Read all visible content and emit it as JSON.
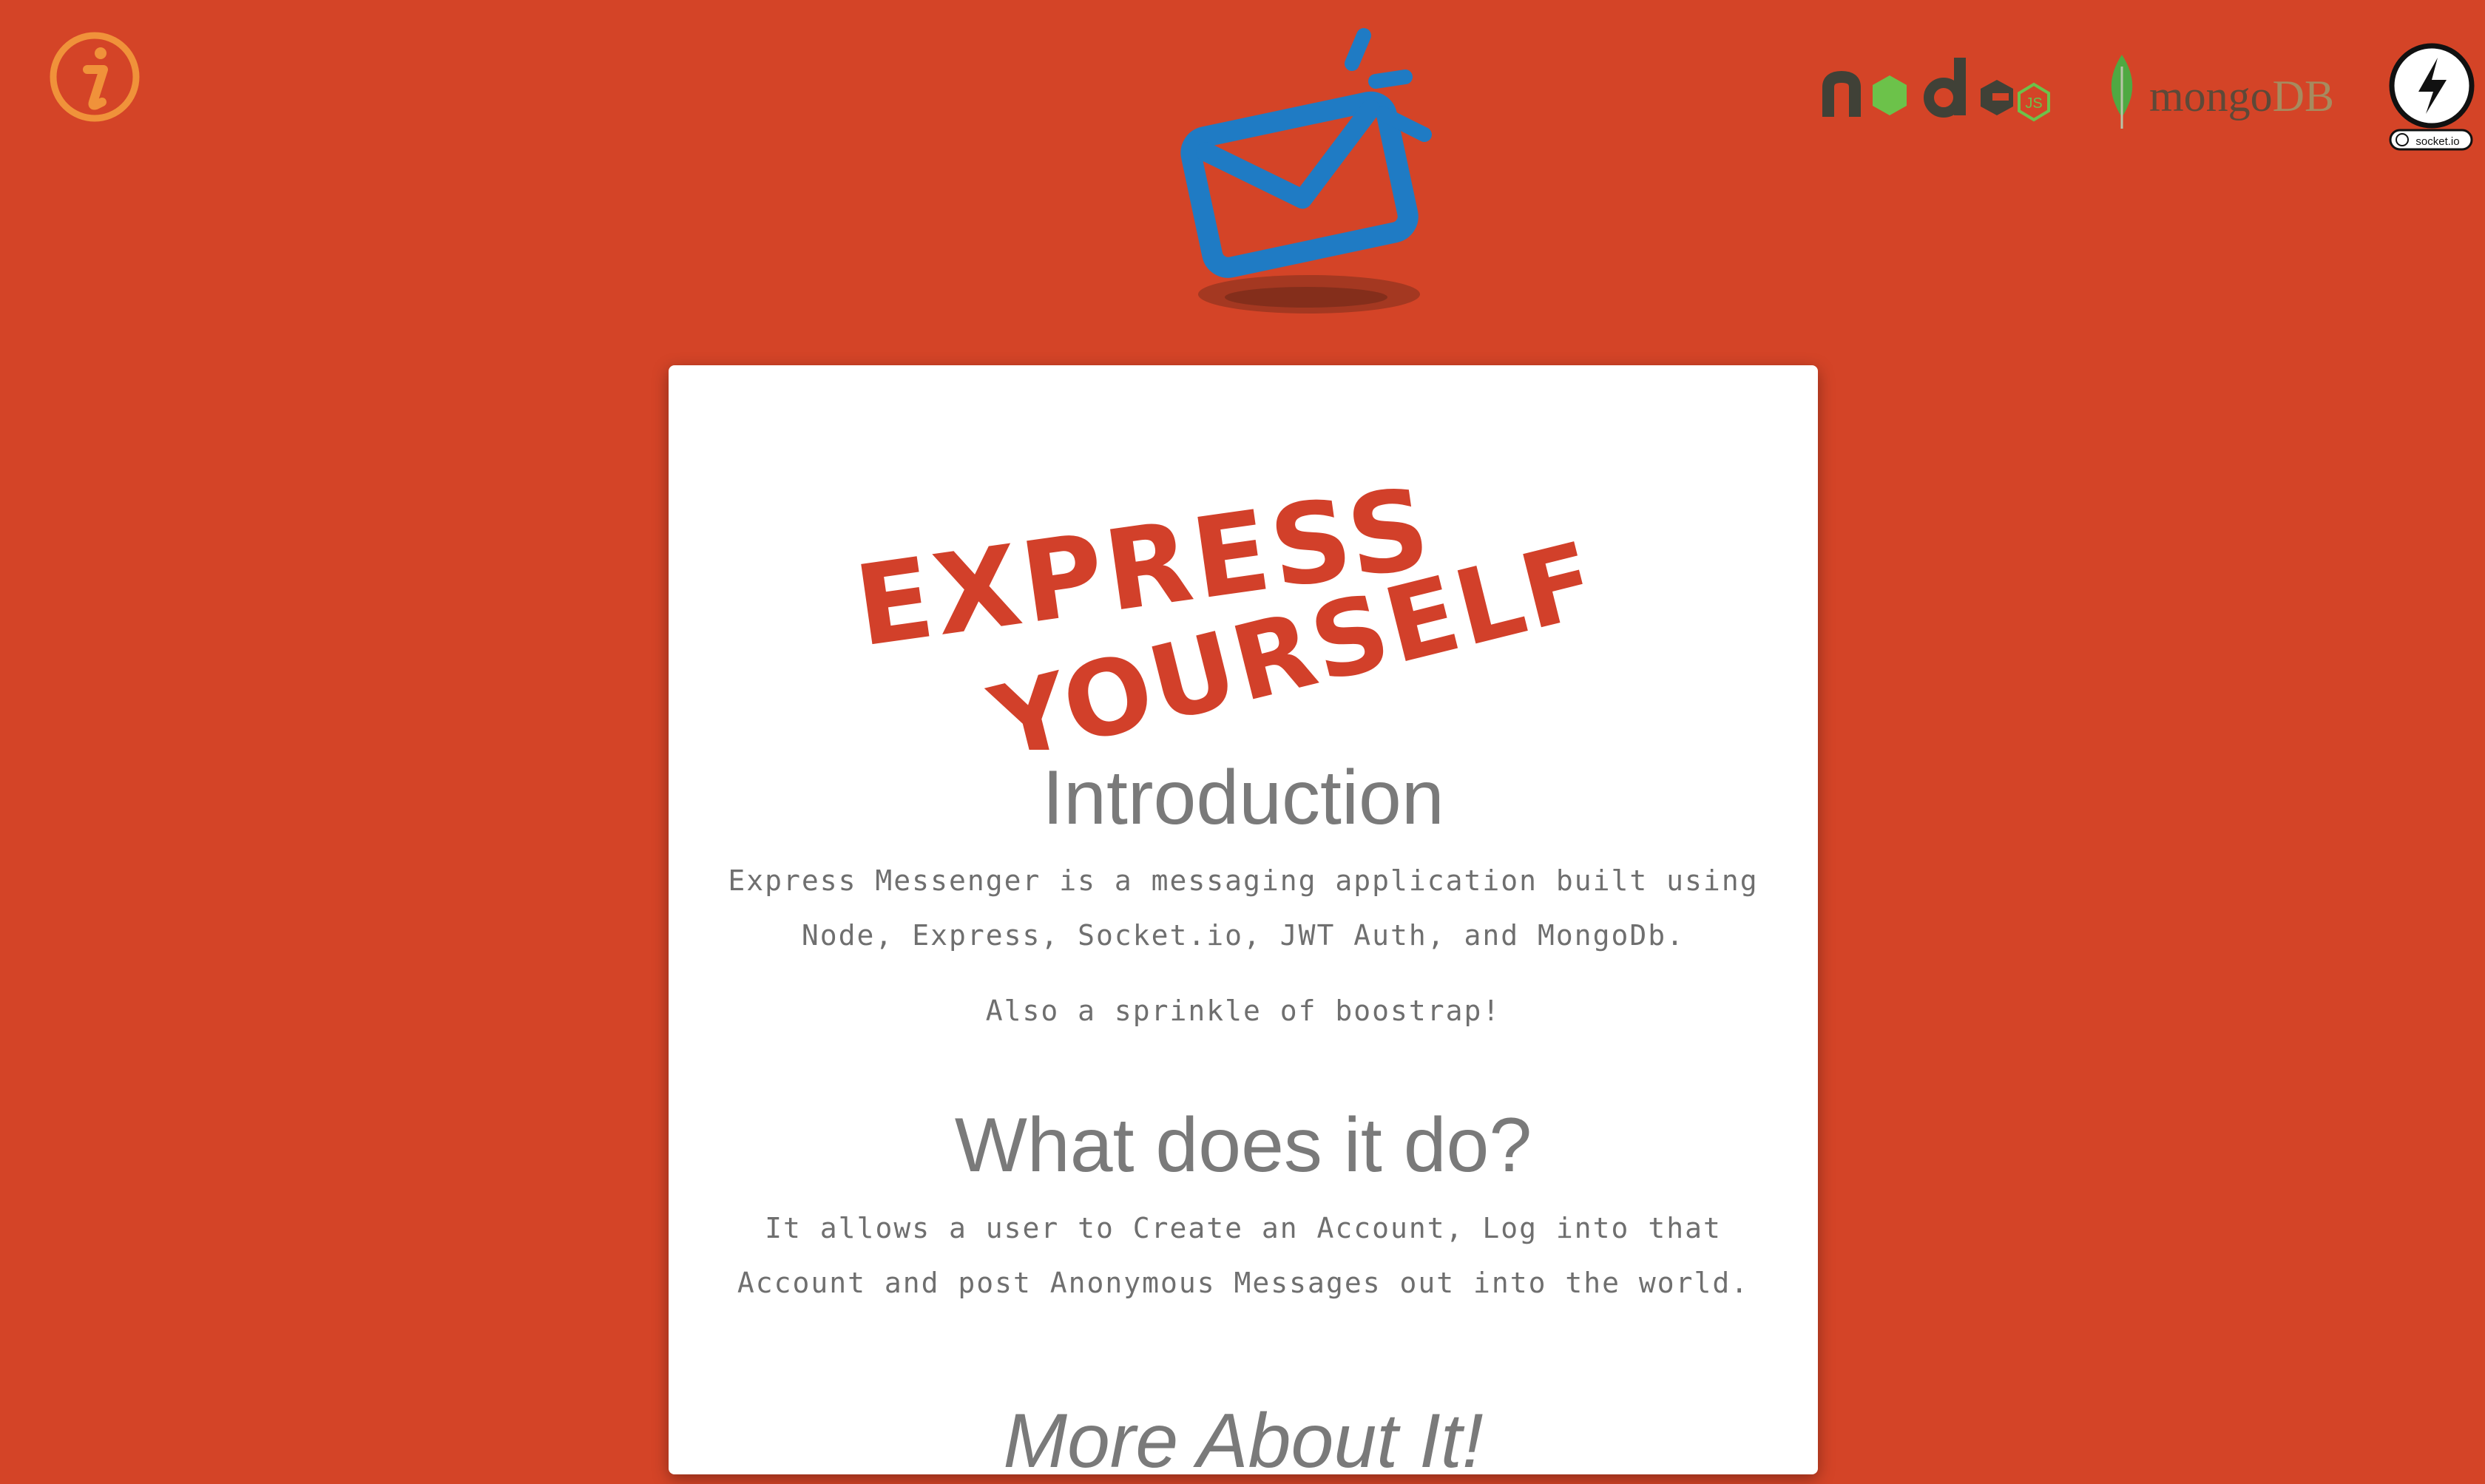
{
  "header": {
    "info_icon": "info-icon",
    "app_logo": "envelope-logo-icon",
    "tech": {
      "node_label": "node",
      "mongo_label_main": "mongo",
      "mongo_label_db": "DB",
      "socket_label": "socket.io"
    }
  },
  "card": {
    "hero_text": "EXPRESS YOURSELF",
    "intro": {
      "title": "Introduction",
      "paragraph": "Express Messenger is a messaging application built using Node, Express, Socket.io, JWT Auth, and MongoDb.",
      "sprinkle": "Also a sprinkle of boostrap!"
    },
    "what": {
      "title": "What does it do?",
      "paragraph": "It allows a user to Create an Account, Log into that Account and post Anonymous Messages out into the world."
    },
    "more": {
      "title": "More About It!"
    }
  },
  "colors": {
    "background": "#d44427",
    "accent_orange": "#f0923a",
    "envelope_blue": "#1f7bc4",
    "graffiti_red": "#d2402a",
    "text_gray": "#7a7a7a"
  }
}
